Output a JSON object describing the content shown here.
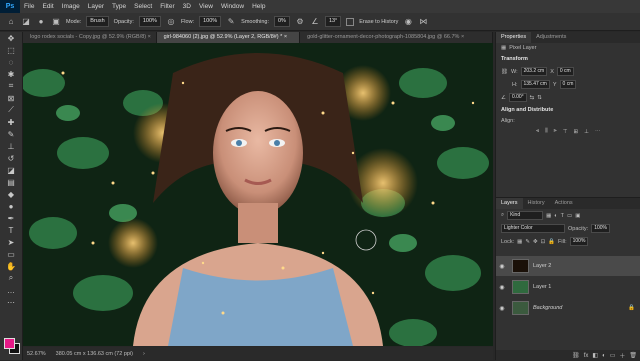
{
  "app": {
    "logo": "Ps"
  },
  "menu": [
    "File",
    "Edit",
    "Image",
    "Layer",
    "Type",
    "Select",
    "Filter",
    "3D",
    "View",
    "Window",
    "Help"
  ],
  "options": {
    "mode_label": "Mode:",
    "mode_value": "Brush",
    "opacity_label": "Opacity:",
    "opacity_value": "100%",
    "flow_label": "Flow:",
    "flow_value": "100%",
    "smoothing_label": "Smoothing:",
    "smoothing_value": "0%",
    "angle_value": "13°",
    "erase_history": "Erase to History"
  },
  "tabs": [
    {
      "label": "logo rodex socials - Copy.jpg @ 52.9% (RGB/8) ×",
      "active": false
    },
    {
      "label": "girl-984060 (2).jpg @ 52.9% (Layer 2, RGB/8#) * ×",
      "active": true
    },
    {
      "label": "gold-glitter-ornament-decor-photograph-1085804.jpg @ 66.7% ×",
      "active": false
    }
  ],
  "status": {
    "zoom": "52.67%",
    "doc": "380.05 cm x 136.63 cm (72 ppi)"
  },
  "properties": {
    "tabs": [
      "Properties",
      "Adjustments"
    ],
    "kind": "Pixel Layer",
    "transform_title": "Transform",
    "w_label": "W:",
    "w_value": "203.2 cm",
    "h_label": "H:",
    "h_value": "135.47 cm",
    "x_label": "X",
    "x_value": "0 cm",
    "y_label": "Y",
    "y_value": "0 cm",
    "angle_value": "0.00°",
    "align_title": "Align and Distribute",
    "align_label": "Align:"
  },
  "layers_panel": {
    "tabs": [
      "Layers",
      "History",
      "Actions"
    ],
    "filter_kind": "Kind",
    "blend_mode": "Lighter Color",
    "opacity_label": "Opacity:",
    "opacity_value": "100%",
    "lock_label": "Lock:",
    "fill_label": "Fill:",
    "fill_value": "100%",
    "layers": [
      {
        "name": "Layer 2",
        "selected": true
      },
      {
        "name": "Layer 1",
        "selected": false
      },
      {
        "name": "Background",
        "selected": false
      }
    ],
    "bottom_icons": [
      "link-icon",
      "fx-icon",
      "mask-icon",
      "adjustment-icon",
      "group-icon",
      "new-layer-icon",
      "trash-icon"
    ]
  },
  "colors": {
    "foreground": "#e61987",
    "background": "#111111",
    "accent": "#31a8ff"
  }
}
